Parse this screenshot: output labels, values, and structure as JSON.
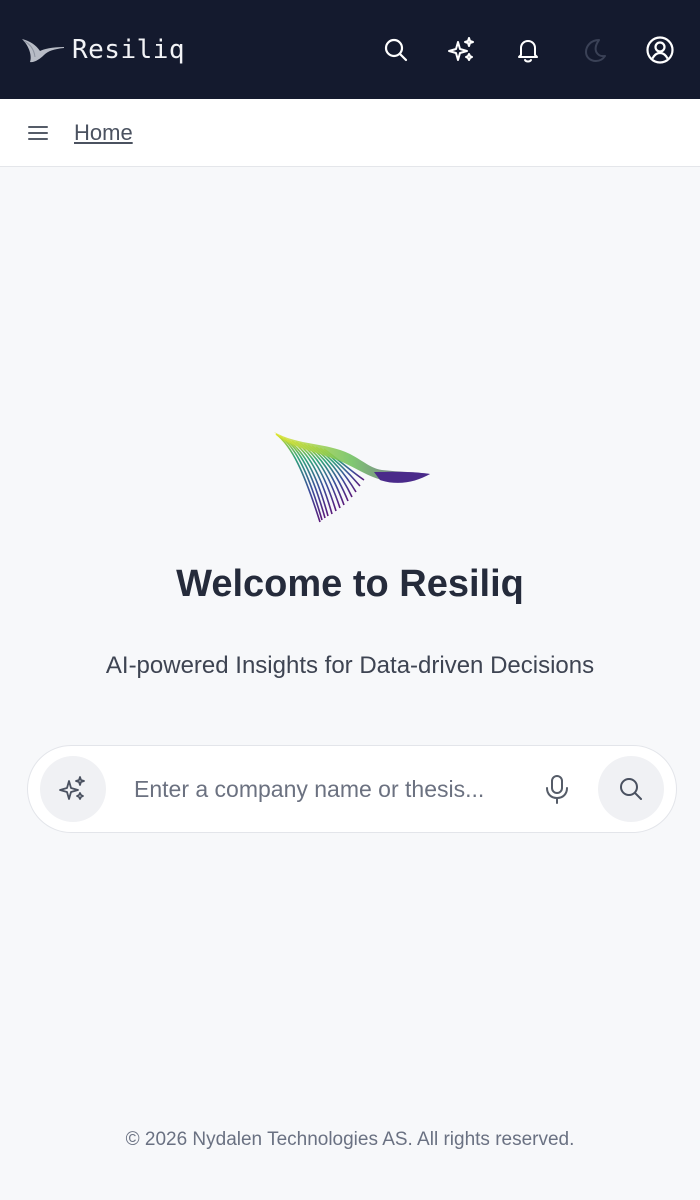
{
  "header": {
    "brand_name": "Resiliq",
    "icons": [
      "search-icon",
      "sparkles-icon",
      "bell-icon",
      "moon-icon",
      "user-circle-icon"
    ]
  },
  "breadcrumb": {
    "home_label": "Home"
  },
  "main": {
    "title": "Welcome to Resiliq",
    "subtitle": "AI-powered Insights for Data-driven Decisions"
  },
  "search": {
    "placeholder": "Enter a company name or thesis...",
    "value": ""
  },
  "footer": {
    "copyright": "© 2026 Nydalen Technologies AS. All rights reserved."
  },
  "colors": {
    "topbar_bg": "#141a2e",
    "page_bg": "#f7f8fa",
    "title_text": "#252b3b"
  }
}
